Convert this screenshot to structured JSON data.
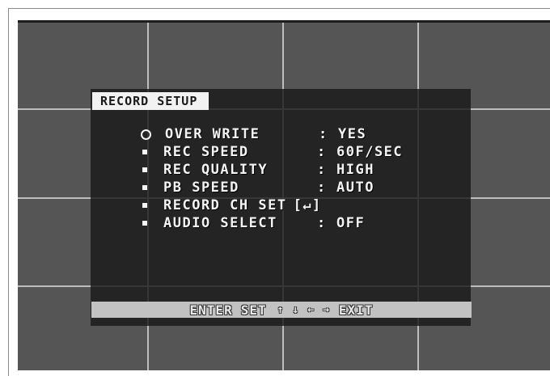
{
  "screen": {
    "title": "RECORD SETUP",
    "background_color": "#555555",
    "panel_color": "#1a1a1a",
    "grid_color": "#bdbdbd"
  },
  "menu": {
    "items": [
      {
        "bullet": "circle",
        "label": "OVER WRITE",
        "separator": ":",
        "value": "YES"
      },
      {
        "bullet": "square",
        "label": "REC SPEED",
        "separator": ":",
        "value": "60F/SEC"
      },
      {
        "bullet": "square",
        "label": "REC QUALITY",
        "separator": ":",
        "value": "HIGH"
      },
      {
        "bullet": "square",
        "label": "PB SPEED",
        "separator": ":",
        "value": "AUTO"
      },
      {
        "bullet": "square",
        "label": "RECORD CH SET",
        "separator": "",
        "value": "[↵]"
      },
      {
        "bullet": "square",
        "label": "AUDIO SELECT",
        "separator": ":",
        "value": "OFF"
      }
    ]
  },
  "help": {
    "enter": "ENTER",
    "set": "SET",
    "arrows": [
      "↑",
      "↓",
      "←",
      "→"
    ],
    "exit": "EXIT",
    "arrow_icons": [
      "arrow-up-icon",
      "arrow-down-icon",
      "arrow-left-icon",
      "arrow-right-icon"
    ]
  }
}
